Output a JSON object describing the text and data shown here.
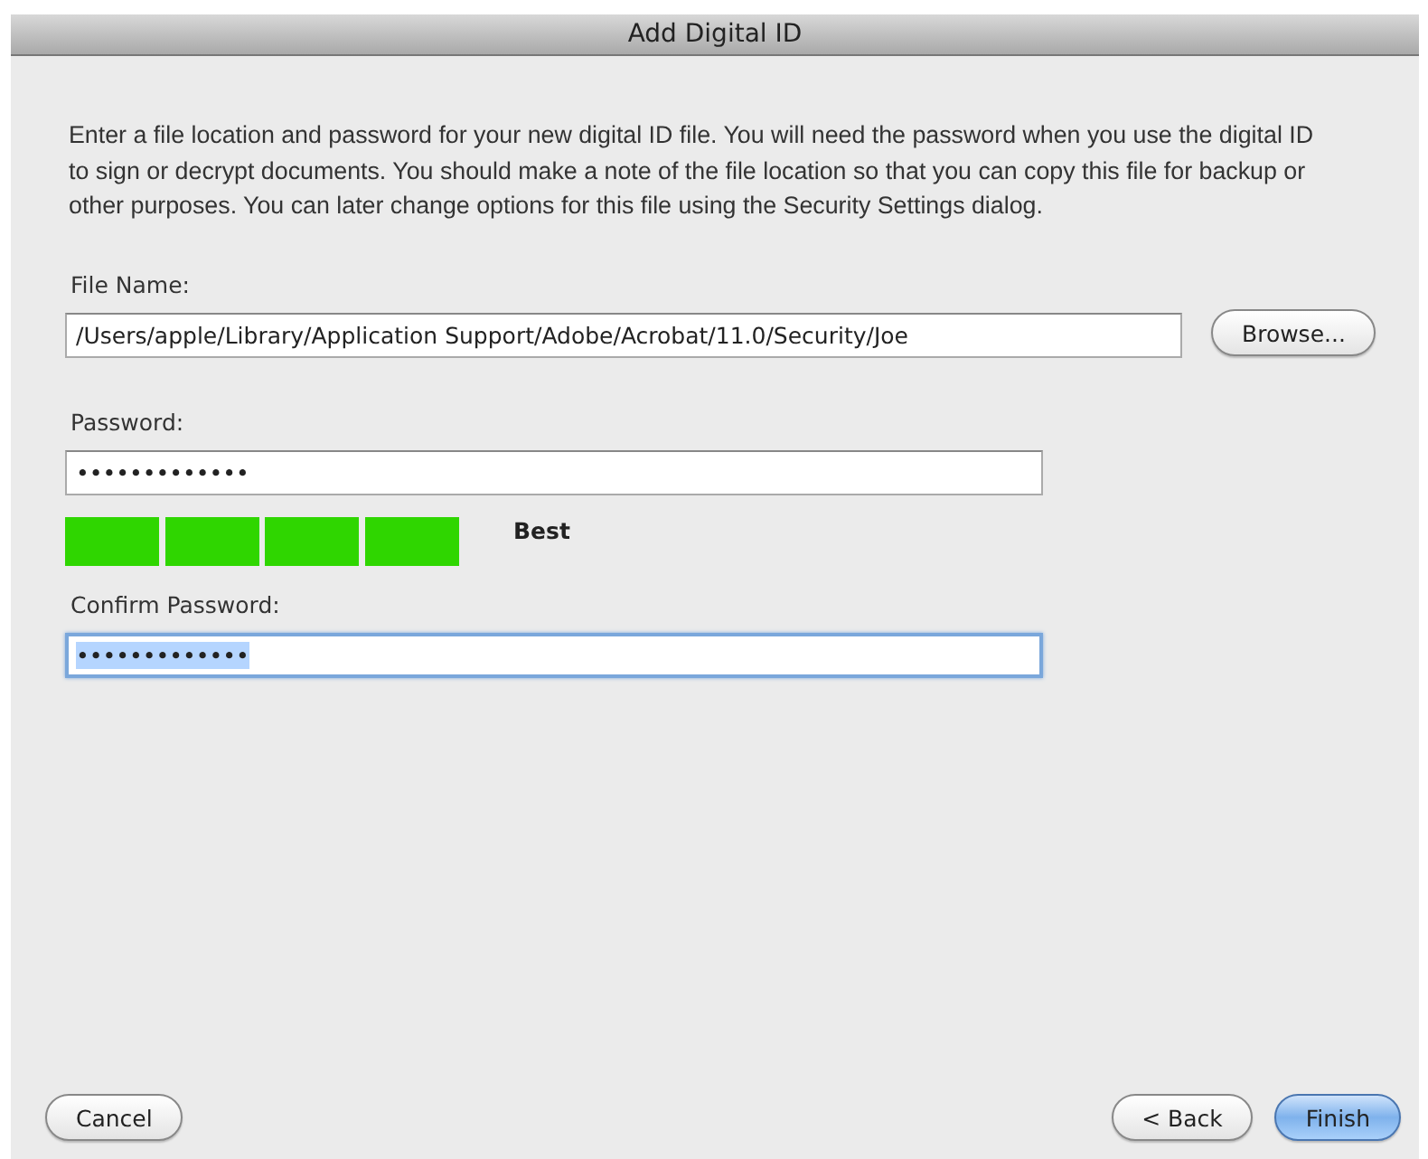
{
  "window": {
    "title": "Add Digital ID"
  },
  "intro": "Enter a file location and password for your new digital ID file. You will need the password when you use the digital ID to sign or decrypt documents. You should make a note of the file location so that you can copy this file for backup or other purposes. You can later change options for this file using the Security Settings dialog.",
  "file_name": {
    "label": "File Name:",
    "value": "/Users/apple/Library/Application Support/Adobe/Acrobat/11.0/Security/Joe",
    "browse": "Browse..."
  },
  "password": {
    "label": "Password:",
    "value": "•••••••••••••",
    "focused": false,
    "selected": false
  },
  "strength": {
    "level": 1,
    "label": "Best"
  },
  "confirm_password": {
    "label": "Confirm Password:",
    "value": "•••••••••••••",
    "focused": true,
    "selected": true
  },
  "buttons": [
    {
      "label": "Cancel",
      "default": false
    },
    {
      "label": "< Back",
      "default": false
    },
    {
      "label": "Finish",
      "default": true
    }
  ]
}
